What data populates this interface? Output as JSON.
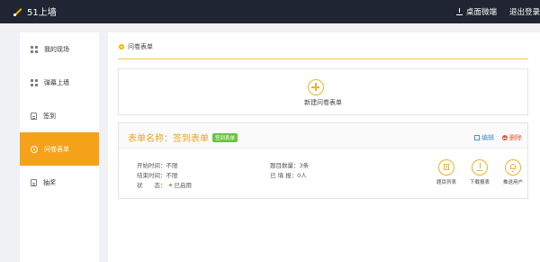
{
  "header": {
    "app_title": "51上墙",
    "desktop_link": "桌面微端",
    "logout": "退出登录"
  },
  "sidebar": {
    "items": [
      {
        "label": "我的现场",
        "icon": "grid-icon"
      },
      {
        "label": "弹幕上墙",
        "icon": "grid-icon"
      },
      {
        "label": "签到",
        "icon": "document-icon"
      },
      {
        "label": "问卷表单",
        "icon": "gear-icon",
        "active": true
      },
      {
        "label": "抽奖",
        "icon": "document-icon"
      }
    ]
  },
  "main": {
    "breadcrumb": "问卷表单",
    "new_form_label": "新建问卷表单",
    "form": {
      "title": "表单名称：签到表单",
      "badge": "签到表单",
      "edit": "编辑",
      "delete": "删除",
      "start_time": "开始时间：不限",
      "end_time": "结束时间：不限",
      "status_label": "状　　态：",
      "status_value": "已启用",
      "question_count": "题目数量：3条",
      "filled_count": "已 填 报：0人",
      "actions": {
        "questions": "题目列表",
        "download": "下载报表",
        "push": "推送用户"
      }
    }
  },
  "colors": {
    "accent": "#f5a21a",
    "topbar": "#1f2532",
    "badge": "#6cc24a",
    "edit": "#4a90d9",
    "delete": "#e05a3a"
  }
}
